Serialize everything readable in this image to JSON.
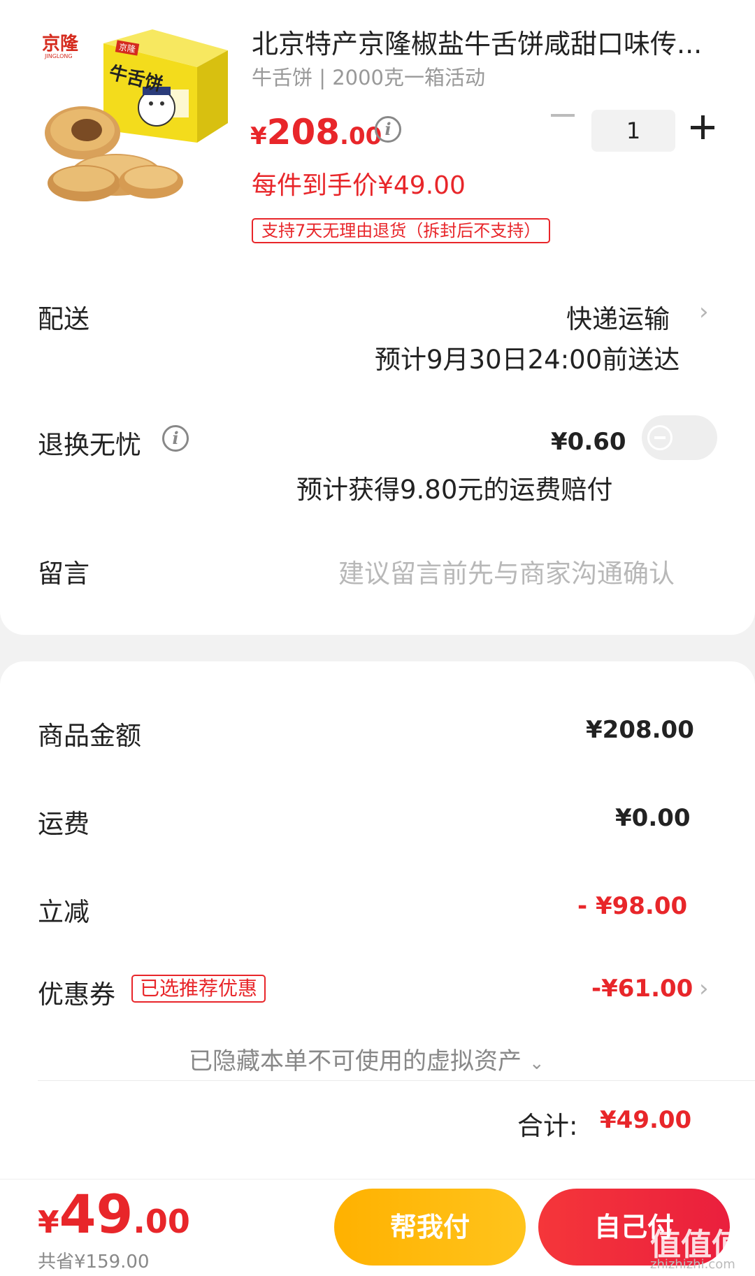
{
  "product": {
    "title": "北京特产京隆椒盐牛舌饼咸甜口味传...",
    "spec": "牛舌饼 | 2000克一箱活动",
    "price_currency": "¥",
    "price_int": "208",
    "price_dec": ".00",
    "unit_price": "每件到手价¥49.00",
    "return_tag": "支持7天无理由退货（拆封后不支持）",
    "quantity": "1",
    "image_labels": {
      "brand": "京隆",
      "brand_sub": "JINGLONG",
      "box_text": "牛舌饼",
      "box_brand": "京隆"
    }
  },
  "delivery": {
    "label": "配送",
    "method": "快递运输",
    "eta": "预计9月30日24:00前送达"
  },
  "return_insurance": {
    "label": "退换无忧",
    "price": "¥0.60",
    "note": "预计获得9.80元的运费赔付",
    "enabled": false
  },
  "message": {
    "label": "留言",
    "placeholder": "建议留言前先与商家沟通确认"
  },
  "summary": {
    "goods_label": "商品金额",
    "goods_value": "¥208.00",
    "shipping_label": "运费",
    "shipping_value": "¥0.00",
    "discount_label": "立减",
    "discount_value": "- ¥98.00",
    "coupon_label": "优惠券",
    "coupon_tag": "已选推荐优惠",
    "coupon_value": "-¥61.00",
    "hidden_assets": "已隐藏本单不可使用的虚拟资产",
    "total_label": "合计:",
    "total_value": "¥49.00"
  },
  "bottom": {
    "currency": "¥",
    "price_int": "49",
    "price_dec": ".00",
    "saved": "共省¥159.00",
    "help_pay": "帮我付",
    "self_pay": "自己付"
  },
  "watermark": {
    "text": "值值值",
    "url": "zhizhizhi.com"
  },
  "colors": {
    "accent_red": "#e8262a",
    "help_button": "#ffb800",
    "pay_button": "#f0283c"
  },
  "icons": {
    "info": "info-circle-icon",
    "chevron": "chevron-right-icon",
    "expand": "chevron-down-icon"
  }
}
